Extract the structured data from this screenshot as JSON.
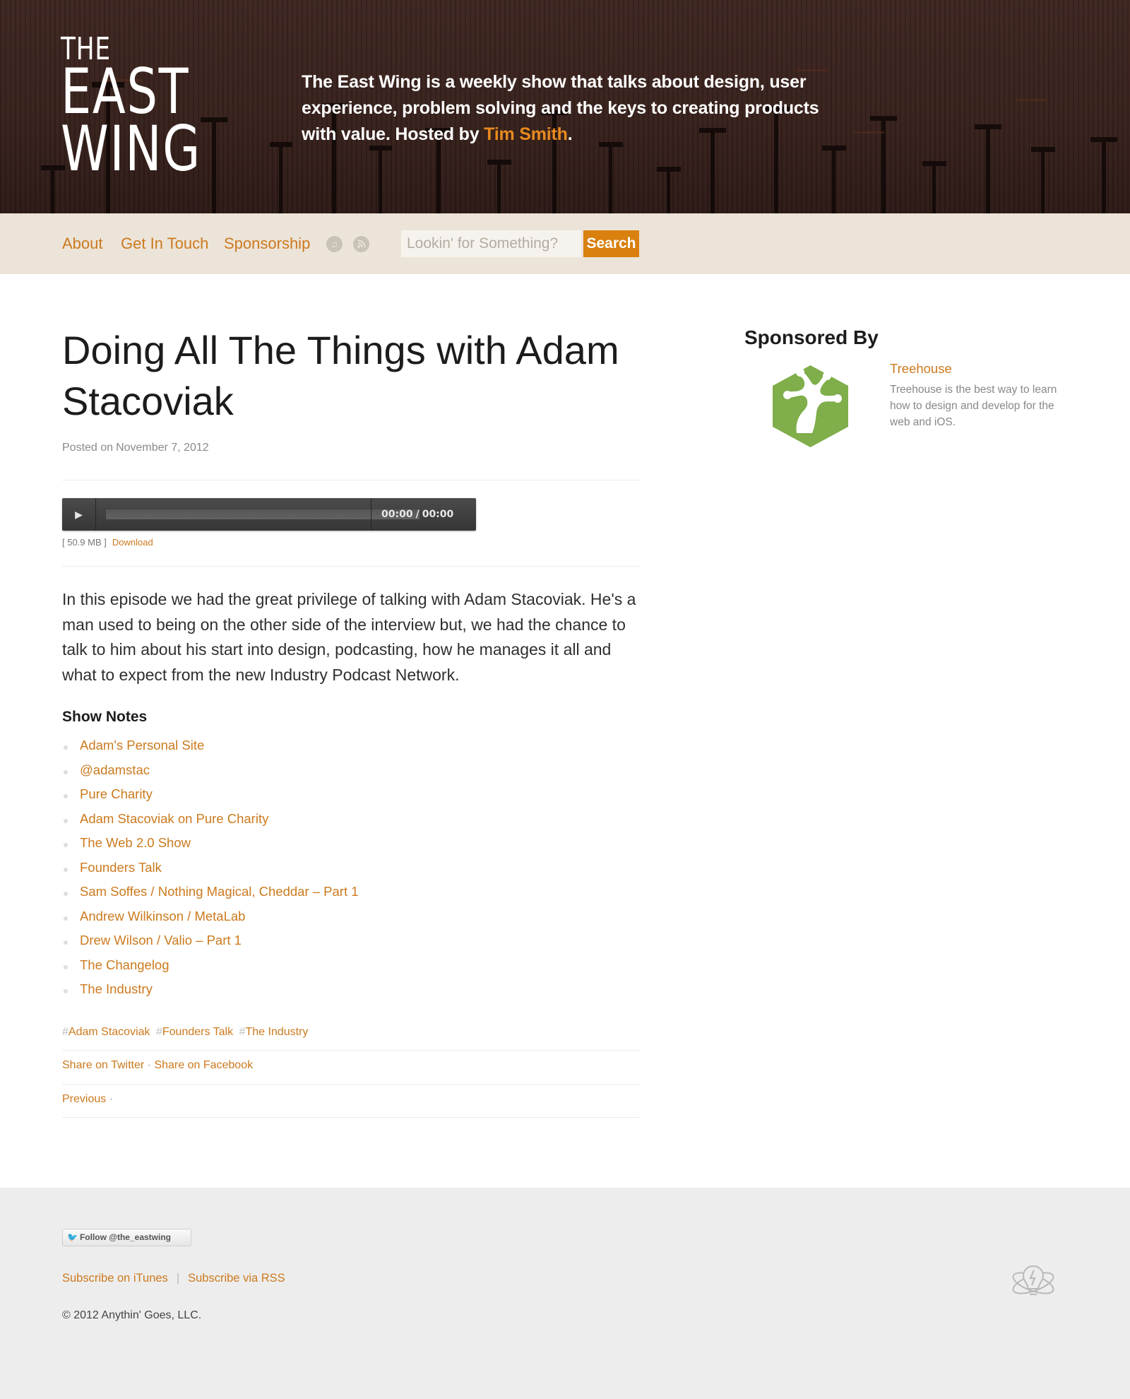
{
  "header": {
    "logo": [
      "THE",
      "EAST",
      "WING"
    ],
    "tagline_before_link": "The East Wing is a weekly show that talks about design, user experience, problem solving and the keys to creating products with value. Hosted by ",
    "tagline_link": "Tim Smith",
    "tagline_after_link": "."
  },
  "nav": {
    "links": [
      "About",
      "Get In Touch",
      "Sponsorship"
    ],
    "icons": [
      "itunes-icon",
      "rss-icon"
    ],
    "search_placeholder": "Lookin' for Something?",
    "search_button": "Search"
  },
  "post": {
    "title": "Doing All The Things with Adam Stacoviak",
    "date_label": "Posted on",
    "date": "November 7, 2012",
    "player": {
      "current_time": "00:00",
      "total_time": "00:00",
      "progress": 0
    },
    "file_size": "[ 50.9 MB ]",
    "download_label": "Download",
    "intro": "In this episode we had the great privilege of talking with Adam Stacoviak. He's a man used to being on the other side of the interview but, we had the chance to talk to him about his start into design, podcasting, how he manages it all and what to expect from the new Industry Podcast Network.",
    "show_notes_heading": "Show Notes",
    "show_notes": [
      "Adam's Personal Site",
      "@adamstac",
      "Pure Charity",
      "Adam Stacoviak on Pure Charity",
      "The Web 2.0 Show",
      "Founders Talk",
      "Sam Soffes / Nothing Magical, Cheddar – Part 1",
      "Andrew Wilkinson / MetaLab",
      "Drew Wilson / Valio – Part 1",
      "The Changelog",
      "The Industry"
    ],
    "tags": [
      "Adam Stacoviak",
      "Founders Talk",
      "The Industry"
    ],
    "share_twitter": "Share on Twitter",
    "share_separator": "·",
    "share_facebook": "Share on Facebook",
    "previous": "Previous",
    "previous_separator": "·"
  },
  "sidebar": {
    "heading": "Sponsored By",
    "sponsor_name": "Treehouse",
    "sponsor_description": "Treehouse is the best way to learn how to design and develop for the web and iOS.",
    "sponsor_logo": "treehouse-logo",
    "sponsor_logo_color": "#7fae4a"
  },
  "footer": {
    "follow_button": "Follow @the_eastwing",
    "subscribe_itunes": "Subscribe on iTunes",
    "subscribe_separator": "|",
    "subscribe_rss": "Subscribe via RSS",
    "copyright": "© 2012 Anythin' Goes, LLC.",
    "brand_icon": "lightbulb-atom-icon"
  },
  "colors": {
    "accent": "#cc7a1e",
    "search_button": "#d9800f",
    "nav_background": "#ece4d8",
    "header_background": "#3a231e",
    "footer_background": "#ededed"
  }
}
